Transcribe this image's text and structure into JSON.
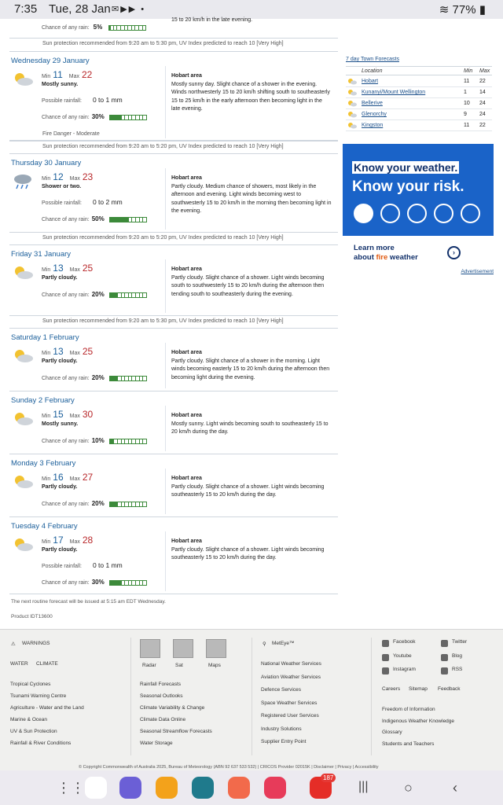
{
  "status": {
    "time": "7:35",
    "date": "Tue, 28 Jan",
    "battery": "77%"
  },
  "top_tail": {
    "rain_chance_label": "Chance of any rain:",
    "rain_chance": "5%",
    "text_tail": "15 to 20 km/h in the late evening.",
    "sun": "Sun protection recommended from 9:20 am to 5:30 pm, UV Index predicted to reach 10 [Very High]"
  },
  "labels": {
    "min": "Min",
    "max": "Max",
    "possible_rainfall": "Possible rainfall:",
    "chance_rain": "Chance of any rain:",
    "area": "Hobart area"
  },
  "days": [
    {
      "heading": "Wednesday 29 January",
      "min": "11",
      "max": "22",
      "summary": "Mostly sunny.",
      "rainfall": "0 to 1 mm",
      "chance": "30%",
      "chance_frac": 0.3,
      "text": "Mostly sunny day. Slight chance of a shower in the evening. Winds northwesterly 15 to 20 km/h shifting south to southeasterly 15 to 25 km/h in the early afternoon then becoming light in the late evening.",
      "fire": "Fire Danger - Moderate",
      "sun": "Sun protection recommended from 9:20 am to 5:20 pm, UV Index predicted to reach 10 [Very High]"
    },
    {
      "heading": "Thursday 30 January",
      "min": "12",
      "max": "23",
      "summary": "Shower or two.",
      "rainfall": "0 to 2 mm",
      "chance": "50%",
      "chance_frac": 0.5,
      "text": "Partly cloudy. Medium chance of showers, most likely in the afternoon and evening. Light winds becoming west to southwesterly 15 to 20 km/h in the morning then becoming light in the evening.",
      "sun": "Sun protection recommended from 9:20 am to 5:20 pm, UV Index predicted to reach 10 [Very High]"
    },
    {
      "heading": "Friday 31 January",
      "min": "13",
      "max": "25",
      "summary": "Partly cloudy.",
      "chance": "20%",
      "chance_frac": 0.2,
      "text": "Partly cloudy. Slight chance of a shower. Light winds becoming south to southwesterly 15 to 20 km/h during the afternoon then tending south to southeasterly during the evening.",
      "sun": "Sun protection recommended from 9:20 am to 5:30 pm, UV Index predicted to reach 10 [Very High]"
    },
    {
      "heading": "Saturday 1 February",
      "min": "13",
      "max": "25",
      "summary": "Partly cloudy.",
      "chance": "20%",
      "chance_frac": 0.2,
      "text": "Partly cloudy. Slight chance of a shower in the morning. Light winds becoming easterly 15 to 20 km/h during the afternoon then becoming light during the evening."
    },
    {
      "heading": "Sunday 2 February",
      "min": "15",
      "max": "30",
      "summary": "Mostly sunny.",
      "chance": "10%",
      "chance_frac": 0.1,
      "text": "Mostly sunny. Light winds becoming south to southeasterly 15 to 20 km/h during the day."
    },
    {
      "heading": "Monday 3 February",
      "min": "16",
      "max": "27",
      "summary": "Partly cloudy.",
      "chance": "20%",
      "chance_frac": 0.2,
      "text": "Partly cloudy. Slight chance of a shower. Light winds becoming southeasterly 15 to 20 km/h during the day."
    },
    {
      "heading": "Tuesday 4 February",
      "min": "17",
      "max": "28",
      "summary": "Partly cloudy.",
      "rainfall": "0 to 1 mm",
      "chance": "30%",
      "chance_frac": 0.3,
      "text": "Partly cloudy. Slight chance of a shower. Light winds becoming southeasterly 15 to 20 km/h during the day."
    }
  ],
  "notes": {
    "next_issue": "The next routine forecast will be issued at 5:15 am EDT Wednesday.",
    "product": "Product IDT13600"
  },
  "towns": {
    "title": "7 day Town Forecasts",
    "h_location": "Location",
    "h_min": "Min",
    "h_max": "Max",
    "rows": [
      {
        "name": "Hobart",
        "min": "11",
        "max": "22"
      },
      {
        "name": "Kunanyi/Mount Wellington",
        "min": "1",
        "max": "14"
      },
      {
        "name": "Bellerive",
        "min": "10",
        "max": "24"
      },
      {
        "name": "Glenorchy",
        "min": "9",
        "max": "24"
      },
      {
        "name": "Kingston",
        "min": "11",
        "max": "22"
      }
    ]
  },
  "ad": {
    "line1": "Know your weather.",
    "line2": "Know your risk.",
    "learn1": "Learn more",
    "learn2a": "about ",
    "learn2b": "fire",
    "learn2c": " weather",
    "advert": "Advertisement"
  },
  "footer": {
    "warnings": "WARNINGS",
    "water": "WATER",
    "climate": "CLIMATE",
    "col1": [
      "Tropical Cyclones",
      "Tsunami Warning Centre",
      "Agriculture - Water and the Land",
      "Marine & Ocean",
      "UV & Sun Protection",
      "Rainfall & River Conditions"
    ],
    "thumbs": [
      "Radar",
      "Sat",
      "Maps"
    ],
    "col2": [
      "Rainfall Forecasts",
      "Seasonal Outlooks",
      "Climate Variability & Change",
      "Climate Data Online",
      "Seasonal Streamflow Forecasts",
      "Water Storage"
    ],
    "meteye": "MetEye™",
    "col3": [
      "National Weather Services",
      "Aviation Weather Services",
      "Defence Services",
      "Space Weather Services",
      "Registered User Services",
      "Industry Solutions",
      "Supplier Entry Point"
    ],
    "social": [
      "Facebook",
      "Twitter",
      "Youtube",
      "Blog",
      "Instagram",
      "RSS"
    ],
    "col4a": [
      "Careers",
      "Sitemap",
      "Feedback"
    ],
    "col4": [
      "Freedom of Information",
      "Indigenous Weather Knowledge",
      "Glossary",
      "Students and Teachers"
    ],
    "copyright": "© Copyright Commonwealth of Australia 2025, Bureau of Meteorology (ABN 92 637 533 532) | CRICOS Provider 02015K | Disclaimer | Privacy | Accessibility"
  },
  "nav": {
    "badge": "187"
  },
  "colors": {
    "min": "#1a5e9a",
    "max": "#b8272a",
    "bar": "#3c8a3a",
    "ad": "#1a63c8"
  }
}
